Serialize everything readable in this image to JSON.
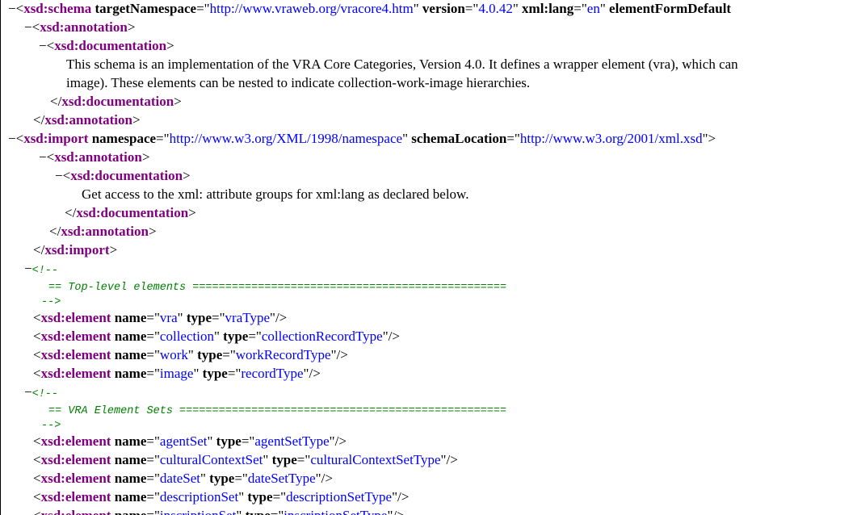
{
  "toggle_symbol": "−",
  "lines": [
    [
      [
        "b",
        "<"
      ],
      [
        "tag",
        "xsd:schema"
      ],
      [
        "t",
        " "
      ],
      [
        "attr",
        "targetNamespace"
      ],
      [
        "b",
        "=\""
      ],
      [
        "val",
        "http://www.vraweb.org/vracore4.htm"
      ],
      [
        "b",
        "\" "
      ],
      [
        "attr",
        "version"
      ],
      [
        "b",
        "=\""
      ],
      [
        "val",
        "4.0.42"
      ],
      [
        "b",
        "\" "
      ],
      [
        "attr",
        "xml:lang"
      ],
      [
        "b",
        "=\""
      ],
      [
        "val",
        "en"
      ],
      [
        "b",
        "\" "
      ],
      [
        "attr",
        "elementFormDefault"
      ]
    ],
    [
      [
        "b",
        "<"
      ],
      [
        "tag",
        "xsd:annotation"
      ],
      [
        "b",
        ">"
      ]
    ],
    [
      [
        "b",
        "<"
      ],
      [
        "tag",
        "xsd:documentation"
      ],
      [
        "b",
        ">"
      ]
    ],
    [
      [
        "t",
        "This schema is an implementation of the VRA Core Categories, Version 4.0. It defines a wrapper element (vra), which can"
      ]
    ],
    [
      [
        "t",
        "image). These elements can be nested to indicate collection-work-image hierarchies."
      ]
    ],
    [
      [
        "b",
        "</"
      ],
      [
        "tag",
        "xsd:documentation"
      ],
      [
        "b",
        ">"
      ]
    ],
    [
      [
        "b",
        "</"
      ],
      [
        "tag",
        "xsd:annotation"
      ],
      [
        "b",
        ">"
      ]
    ],
    [
      [
        "b",
        "<"
      ],
      [
        "tag",
        "xsd:import"
      ],
      [
        "t",
        " "
      ],
      [
        "attr",
        "namespace"
      ],
      [
        "b",
        "=\""
      ],
      [
        "val",
        "http://www.w3.org/XML/1998/namespace"
      ],
      [
        "b",
        "\" "
      ],
      [
        "attr",
        "schemaLocation"
      ],
      [
        "b",
        "=\""
      ],
      [
        "val",
        "http://www.w3.org/2001/xml.xsd"
      ],
      [
        "b",
        "\">"
      ]
    ],
    [
      [
        "b",
        "<"
      ],
      [
        "tag",
        "xsd:annotation"
      ],
      [
        "b",
        ">"
      ]
    ],
    [
      [
        "b",
        "<"
      ],
      [
        "tag",
        "xsd:documentation"
      ],
      [
        "b",
        ">"
      ]
    ],
    [
      [
        "t",
        "Get access to the xml: attribute groups for xml:lang as declared below."
      ]
    ],
    [
      [
        "b",
        "</"
      ],
      [
        "tag",
        "xsd:documentation"
      ],
      [
        "b",
        ">"
      ]
    ],
    [
      [
        "b",
        "</"
      ],
      [
        "tag",
        "xsd:annotation"
      ],
      [
        "b",
        ">"
      ]
    ],
    [
      [
        "b",
        "</"
      ],
      [
        "tag",
        "xsd:import"
      ],
      [
        "b",
        ">"
      ]
    ],
    [
      [
        "c",
        "<!--"
      ]
    ],
    [
      [
        "c",
        "== Top-level elements ================================================"
      ]
    ],
    [
      [
        "c",
        "-->"
      ]
    ],
    [
      [
        "b",
        "<"
      ],
      [
        "tag",
        "xsd:element"
      ],
      [
        "t",
        " "
      ],
      [
        "attr",
        "name"
      ],
      [
        "b",
        "=\""
      ],
      [
        "val",
        "vra"
      ],
      [
        "b",
        "\" "
      ],
      [
        "attr",
        "type"
      ],
      [
        "b",
        "=\""
      ],
      [
        "val",
        "vraType"
      ],
      [
        "b",
        "\"/>"
      ]
    ],
    [
      [
        "b",
        "<"
      ],
      [
        "tag",
        "xsd:element"
      ],
      [
        "t",
        " "
      ],
      [
        "attr",
        "name"
      ],
      [
        "b",
        "=\""
      ],
      [
        "val",
        "collection"
      ],
      [
        "b",
        "\" "
      ],
      [
        "attr",
        "type"
      ],
      [
        "b",
        "=\""
      ],
      [
        "val",
        "collectionRecordType"
      ],
      [
        "b",
        "\"/>"
      ]
    ],
    [
      [
        "b",
        "<"
      ],
      [
        "tag",
        "xsd:element"
      ],
      [
        "t",
        " "
      ],
      [
        "attr",
        "name"
      ],
      [
        "b",
        "=\""
      ],
      [
        "val",
        "work"
      ],
      [
        "b",
        "\" "
      ],
      [
        "attr",
        "type"
      ],
      [
        "b",
        "=\""
      ],
      [
        "val",
        "workRecordType"
      ],
      [
        "b",
        "\"/>"
      ]
    ],
    [
      [
        "b",
        "<"
      ],
      [
        "tag",
        "xsd:element"
      ],
      [
        "t",
        " "
      ],
      [
        "attr",
        "name"
      ],
      [
        "b",
        "=\""
      ],
      [
        "val",
        "image"
      ],
      [
        "b",
        "\" "
      ],
      [
        "attr",
        "type"
      ],
      [
        "b",
        "=\""
      ],
      [
        "val",
        "recordType"
      ],
      [
        "b",
        "\"/>"
      ]
    ],
    [
      [
        "c",
        "<!--"
      ]
    ],
    [
      [
        "c",
        "== VRA Element Sets =================================================="
      ]
    ],
    [
      [
        "c",
        "-->"
      ]
    ],
    [
      [
        "b",
        "<"
      ],
      [
        "tag",
        "xsd:element"
      ],
      [
        "t",
        " "
      ],
      [
        "attr",
        "name"
      ],
      [
        "b",
        "=\""
      ],
      [
        "val",
        "agentSet"
      ],
      [
        "b",
        "\" "
      ],
      [
        "attr",
        "type"
      ],
      [
        "b",
        "=\""
      ],
      [
        "val",
        "agentSetType"
      ],
      [
        "b",
        "\"/>"
      ]
    ],
    [
      [
        "b",
        "<"
      ],
      [
        "tag",
        "xsd:element"
      ],
      [
        "t",
        " "
      ],
      [
        "attr",
        "name"
      ],
      [
        "b",
        "=\""
      ],
      [
        "val",
        "culturalContextSet"
      ],
      [
        "b",
        "\" "
      ],
      [
        "attr",
        "type"
      ],
      [
        "b",
        "=\""
      ],
      [
        "val",
        "culturalContextSetType"
      ],
      [
        "b",
        "\"/>"
      ]
    ],
    [
      [
        "b",
        "<"
      ],
      [
        "tag",
        "xsd:element"
      ],
      [
        "t",
        " "
      ],
      [
        "attr",
        "name"
      ],
      [
        "b",
        "=\""
      ],
      [
        "val",
        "dateSet"
      ],
      [
        "b",
        "\" "
      ],
      [
        "attr",
        "type"
      ],
      [
        "b",
        "=\""
      ],
      [
        "val",
        "dateSetType"
      ],
      [
        "b",
        "\"/>"
      ]
    ],
    [
      [
        "b",
        "<"
      ],
      [
        "tag",
        "xsd:element"
      ],
      [
        "t",
        " "
      ],
      [
        "attr",
        "name"
      ],
      [
        "b",
        "=\""
      ],
      [
        "val",
        "descriptionSet"
      ],
      [
        "b",
        "\" "
      ],
      [
        "attr",
        "type"
      ],
      [
        "b",
        "=\""
      ],
      [
        "val",
        "descriptionSetType"
      ],
      [
        "b",
        "\"/>"
      ]
    ],
    [
      [
        "b",
        "<"
      ],
      [
        "tag",
        "xsd:element"
      ],
      [
        "t",
        " "
      ],
      [
        "attr",
        "name"
      ],
      [
        "b",
        "=\""
      ],
      [
        "val",
        "inscriptionSet"
      ],
      [
        "b",
        "\" "
      ],
      [
        "attr",
        "type"
      ],
      [
        "b",
        "=\""
      ],
      [
        "val",
        "inscriptionSetType"
      ],
      [
        "b",
        "\"/>"
      ]
    ]
  ]
}
